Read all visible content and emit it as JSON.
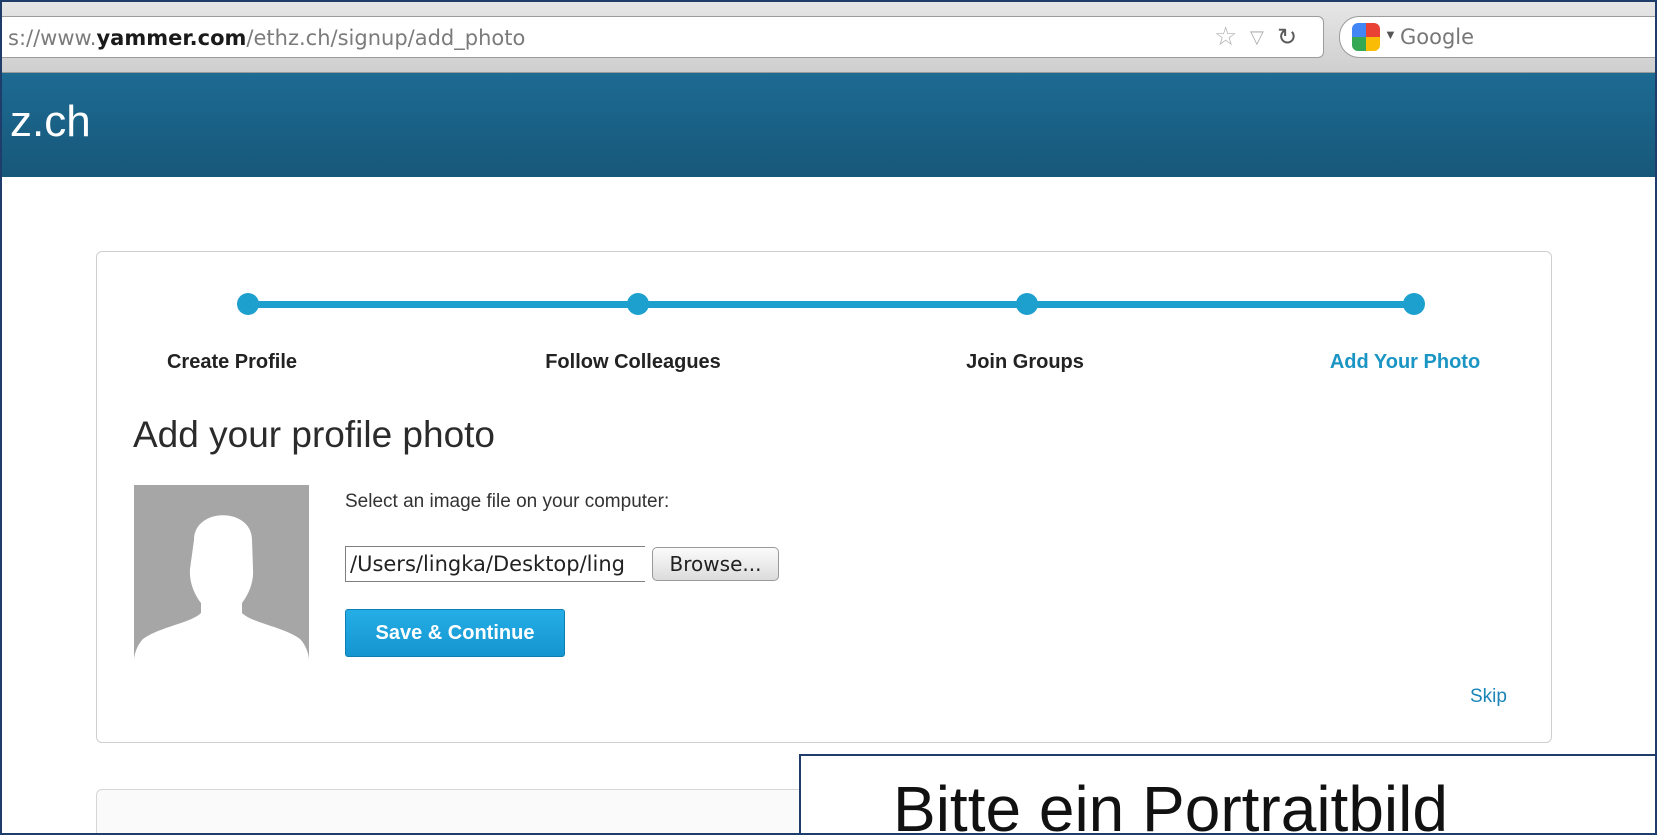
{
  "browser": {
    "url_prefix": "s://www.",
    "url_domain": "yammer.com",
    "url_path": "/ethz.ch/signup/add_photo",
    "search_engine_label": "Google"
  },
  "header": {
    "network_name": "z.ch"
  },
  "steps": [
    {
      "label": "Create Profile",
      "active": false
    },
    {
      "label": "Follow Colleagues",
      "active": false
    },
    {
      "label": "Join Groups",
      "active": false
    },
    {
      "label": "Add Your Photo",
      "active": true
    }
  ],
  "form": {
    "title": "Add your profile photo",
    "select_prompt": "Select an image file on your computer:",
    "file_value": "/Users/lingka/Desktop/ling",
    "browse_label": "Browse...",
    "save_label": "Save & Continue",
    "skip_label": "Skip"
  },
  "overlay": {
    "caption": "Bitte ein Portraitbild"
  },
  "colors": {
    "accent": "#1ea0cf",
    "header": "#1d6a93",
    "save_button": "#1ea6df",
    "link": "#1b85b8"
  }
}
